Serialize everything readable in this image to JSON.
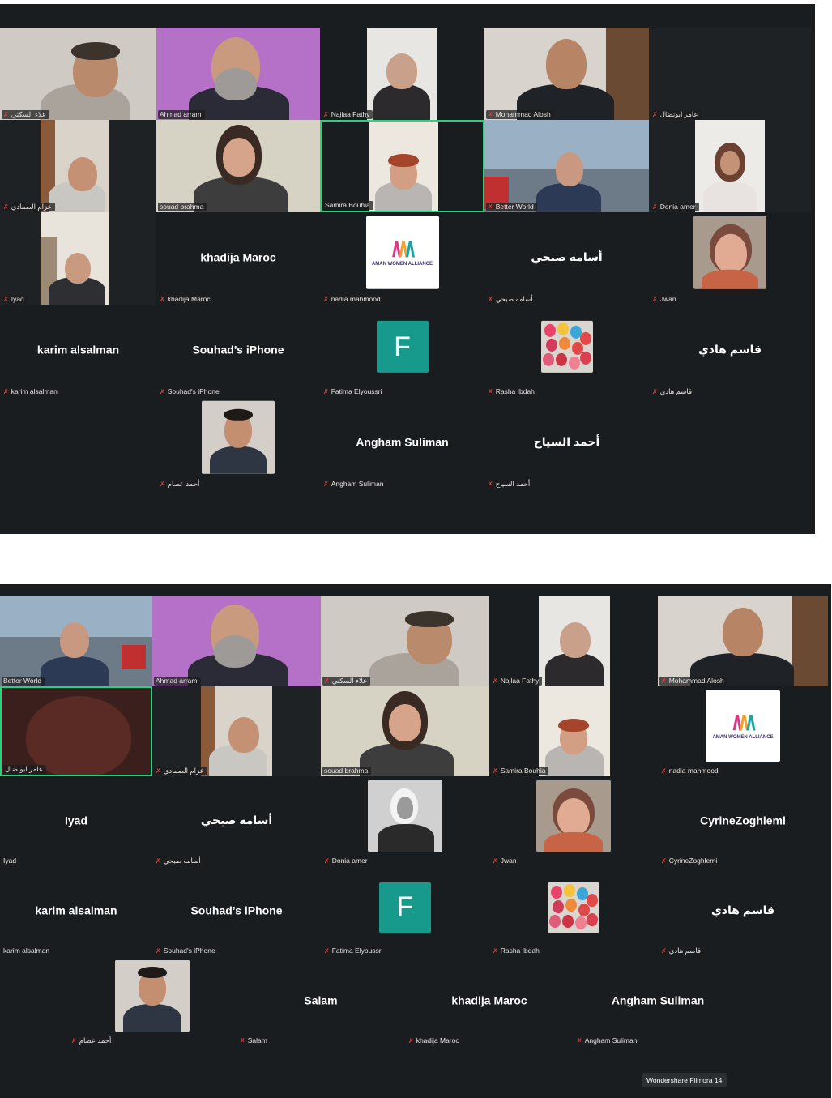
{
  "panel_a": {
    "row1": {
      "t1": "علاء السكني",
      "t2": "Ahmad arram",
      "t3": "Najlaa Fathy",
      "t4": "Mohammad Alosh",
      "t5": "عامر ابونضال"
    },
    "row2": {
      "t1": "عزام الصمادي",
      "t2": "souad brahma",
      "t3": "Samira Bouhia",
      "t4": "Better World",
      "t5": "Donia amer"
    },
    "row3": {
      "t1": "Iyad",
      "t2": "khadija Maroc",
      "t3": "nadia mahmood",
      "t4": "أسامه صبحي",
      "t5": "Jwan"
    },
    "row4": {
      "t1": "karim alsalman",
      "t2": "Souhad’s iPhone",
      "t2_label": "Souhad's iPhone",
      "t3": "Fatima Elyoussri",
      "t3_avatar": "F",
      "t4": "Rasha Ibdah",
      "t5": "قاسم هادي"
    },
    "row5": {
      "t1": "أحمد عصام",
      "t2": "Angham Suliman",
      "t3": "أحمد السياح"
    }
  },
  "panel_b": {
    "row1": {
      "t1": "Better World",
      "t2": "Ahmad arram",
      "t3": "علاء السكني",
      "t4": "Najlaa Fathy",
      "t5": "Mohammad Alosh"
    },
    "row2": {
      "t1": "عامر ابونضال",
      "t2": "عزام الصمادي",
      "t3": "souad brahma",
      "t4": "Samira Bouhia",
      "t5": "nadia mahmood"
    },
    "row3": {
      "t1": "Iyad",
      "t2": "أسامه صبحي",
      "t3": "Donia amer",
      "t4": "Jwan",
      "t5": "CyrineZoghlemi"
    },
    "row4": {
      "t1": "karim alsalman",
      "t2": "Souhad’s iPhone",
      "t2_label": "Souhad's iPhone",
      "t3": "Fatima Elyoussri",
      "t3_avatar": "F",
      "t4": "Rasha Ibdah",
      "t5": "قاسم هادي"
    },
    "row5": {
      "t1": "أحمد عصام",
      "t2": "Salam",
      "t3": "khadija Maroc",
      "t4": "Angham Suliman"
    }
  },
  "logo": {
    "line": "AMAN WOMEN ALLIANCE"
  },
  "watermark": "Wondershare Filmora 14",
  "icons": {
    "muted": "muted-mic-icon"
  },
  "colors": {
    "background": "#1a1d20",
    "active_speaker": "#2bd17e",
    "muted": "#e0443e",
    "avatar_f": "#179a8b"
  }
}
